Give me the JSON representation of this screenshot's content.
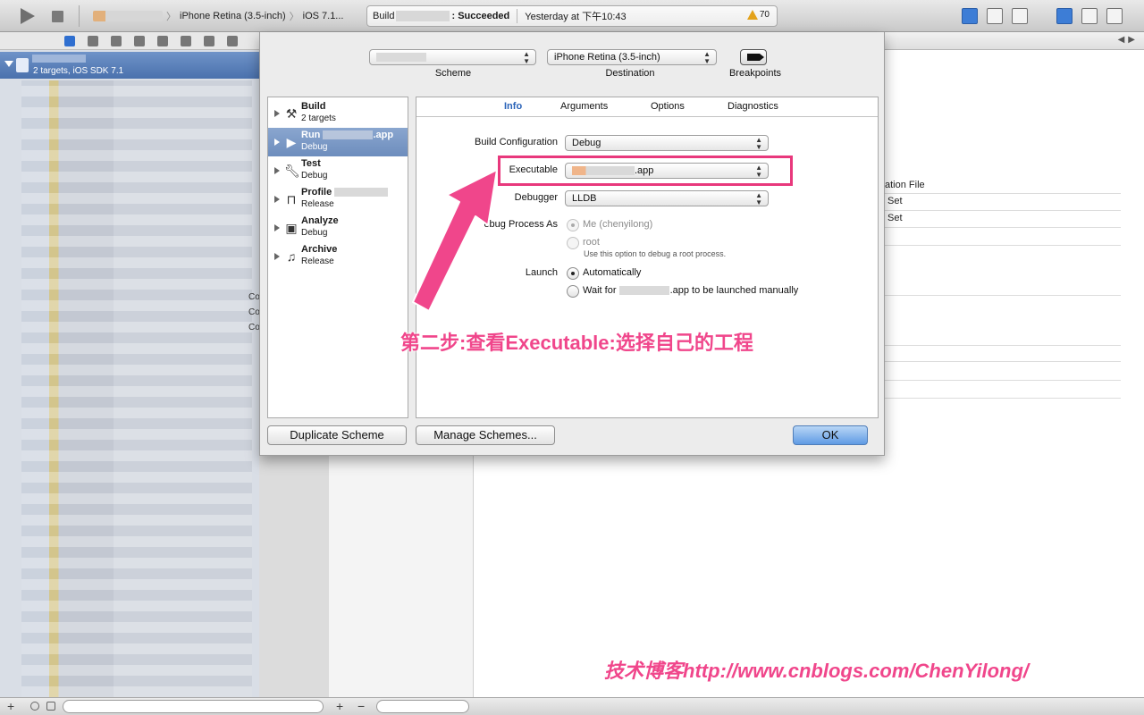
{
  "toolbar": {
    "destination": "iPhone Retina (3.5-inch)",
    "sdk": "iOS 7.1...",
    "path_sep": "〉",
    "activity": {
      "prefix": "Build",
      "status": ": Succeeded",
      "time": "Yesterday at 下午10:43",
      "warnings": "70"
    }
  },
  "navigator": {
    "project_subtitle": "2 targets, iOS SDK 7.1",
    "peek_labels": [
      "Co",
      "Co",
      "Co"
    ]
  },
  "sheet": {
    "scheme_label": "Scheme",
    "destination_label": "Destination",
    "destination_value": "iPhone Retina (3.5-inch)",
    "breakpoints_label": "Breakpoints",
    "actions": [
      {
        "name": "Build",
        "sub": "2 targets",
        "icon": "hammer-icon"
      },
      {
        "name": "Run",
        "name_suffix": ".app",
        "sub": "Debug",
        "icon": "play-icon"
      },
      {
        "name": "Test",
        "sub": "Debug",
        "icon": "wrench-icon"
      },
      {
        "name": "Profile",
        "sub": "Release",
        "icon": "clamp-icon"
      },
      {
        "name": "Analyze",
        "sub": "Debug",
        "icon": "lock-icon"
      },
      {
        "name": "Archive",
        "sub": "Release",
        "icon": "archive-icon"
      }
    ],
    "tabs": [
      "Info",
      "Arguments",
      "Options",
      "Diagnostics"
    ],
    "fields": {
      "build_config_label": "Build Configuration",
      "build_config_value": "Debug",
      "executable_label": "Executable",
      "executable_suffix": ".app",
      "debugger_label": "Debugger",
      "debugger_value": "LLDB",
      "debug_as_label": "ebug Process As",
      "debug_as_me": "Me (chenyilong)",
      "debug_as_root": "root",
      "debug_as_hint": "Use this option to debug a root process.",
      "launch_label": "Launch",
      "launch_auto": "Automatically",
      "launch_wait_prefix": "Wait for",
      "launch_wait_suffix": ".app to be launched manually"
    },
    "buttons": {
      "duplicate": "Duplicate Scheme",
      "manage": "Manage Schemes...",
      "ok": "OK"
    }
  },
  "background": {
    "col_header": "ation File",
    "rows": [
      "Set",
      "Set"
    ]
  },
  "annotations": {
    "step": "第二步:查看Executable:选择自己的工程",
    "blog": "技术博客http://www.cnblogs.com/ChenYilong/",
    "color": "#f0468b"
  },
  "bottom": {
    "plus": "+",
    "minus": "−"
  }
}
